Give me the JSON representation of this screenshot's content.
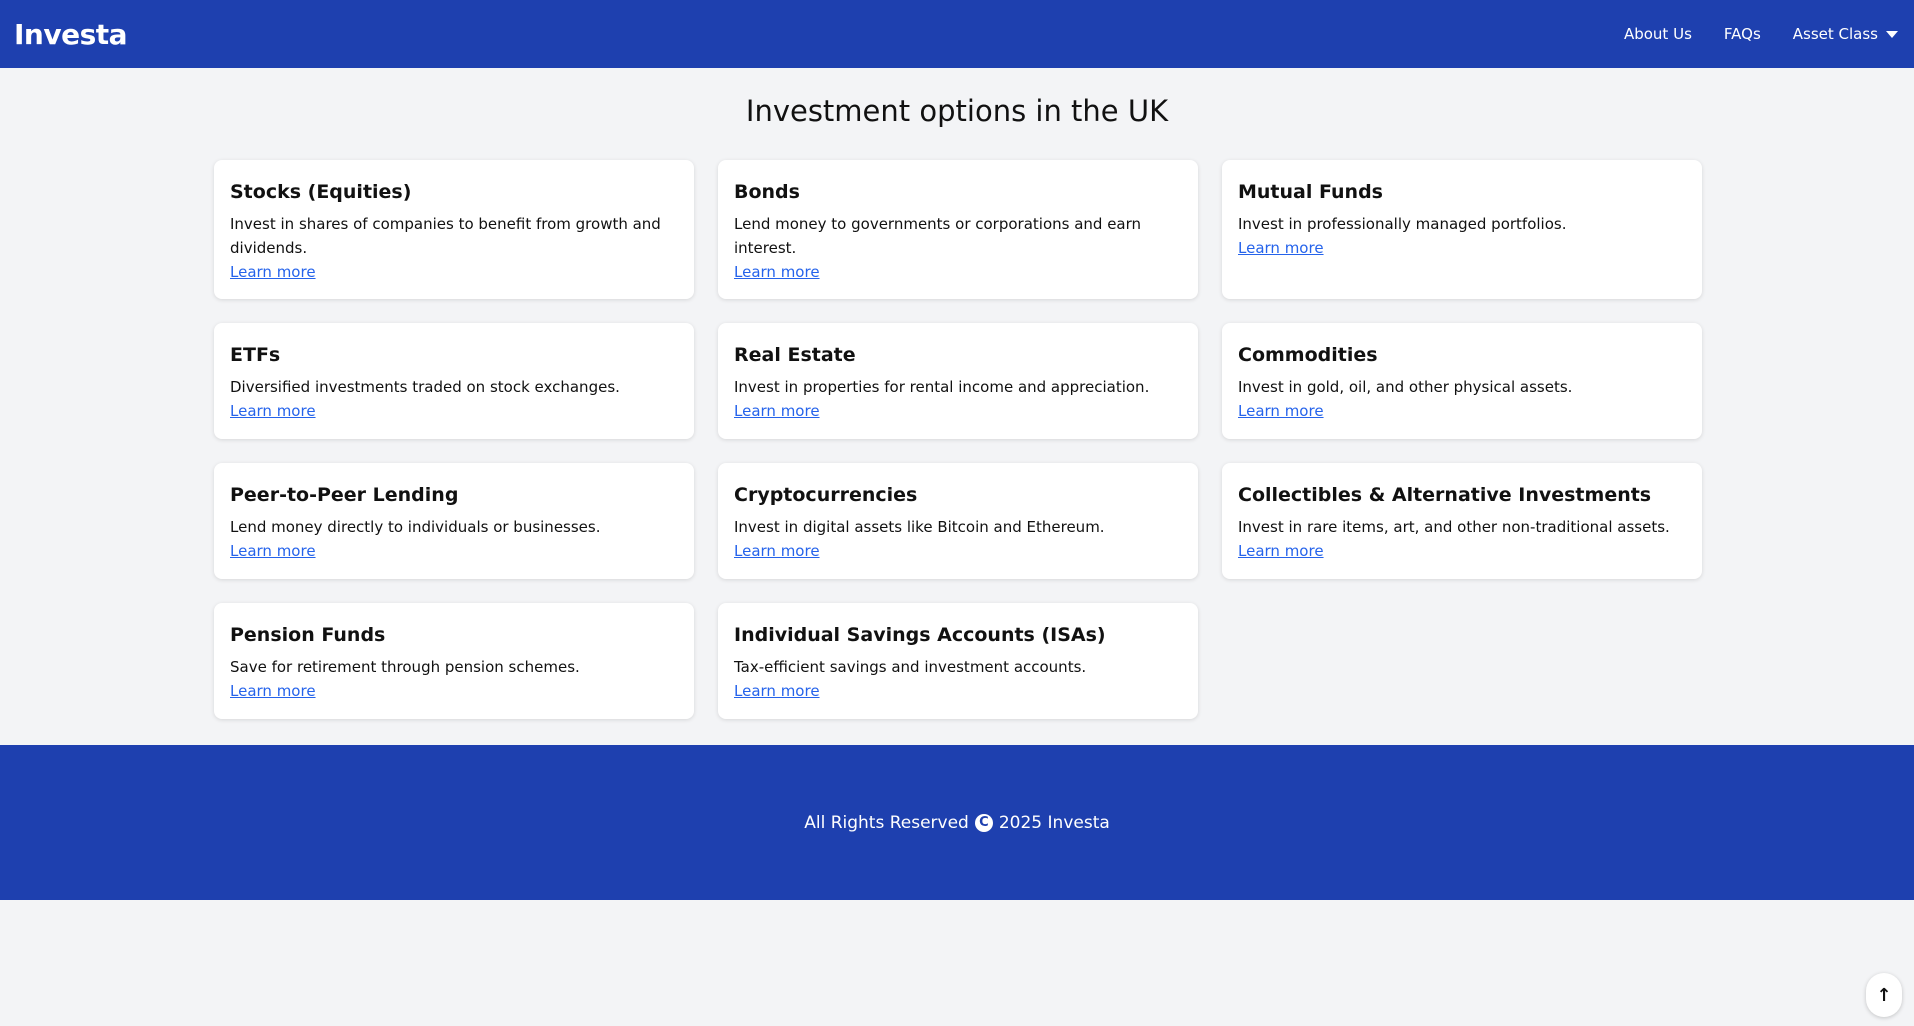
{
  "header": {
    "logo": "Investa",
    "nav": [
      {
        "label": "About Us"
      },
      {
        "label": "FAQs"
      },
      {
        "label": "Asset Class",
        "icon": "caret-down-icon"
      }
    ]
  },
  "main": {
    "title": "Investment options in the UK",
    "cards": [
      {
        "title": "Stocks (Equities)",
        "description": "Invest in shares of companies to benefit from growth and dividends.",
        "link": "Learn more"
      },
      {
        "title": "Bonds",
        "description": "Lend money to governments or corporations and earn interest.",
        "link": "Learn more"
      },
      {
        "title": "Mutual Funds",
        "description": "Invest in professionally managed portfolios.",
        "link": "Learn more"
      },
      {
        "title": "ETFs",
        "description": "Diversified investments traded on stock exchanges.",
        "link": "Learn more"
      },
      {
        "title": "Real Estate",
        "description": "Invest in properties for rental income and appreciation.",
        "link": "Learn more"
      },
      {
        "title": "Commodities",
        "description": "Invest in gold, oil, and other physical assets.",
        "link": "Learn more"
      },
      {
        "title": "Peer-to-Peer Lending",
        "description": "Lend money directly to individuals or businesses.",
        "link": "Learn more"
      },
      {
        "title": "Cryptocurrencies",
        "description": "Invest in digital assets like Bitcoin and Ethereum.",
        "link": "Learn more"
      },
      {
        "title": "Collectibles & Alternative Investments",
        "description": "Invest in rare items, art, and other non-traditional assets.",
        "link": "Learn more"
      },
      {
        "title": "Pension Funds",
        "description": "Save for retirement through pension schemes.",
        "link": "Learn more"
      },
      {
        "title": "Individual Savings Accounts (ISAs)",
        "description": "Tax-efficient savings and investment accounts.",
        "link": "Learn more"
      }
    ]
  },
  "footer": {
    "text_before": "All Rights Reserved",
    "copyright_symbol": "C",
    "text_after": "2025 Investa"
  },
  "scroll_top": {
    "icon": "arrow-up-icon",
    "glyph": "↑"
  },
  "colors": {
    "primary": "#1e40af",
    "background": "#f3f4f6",
    "link": "#2563eb"
  }
}
